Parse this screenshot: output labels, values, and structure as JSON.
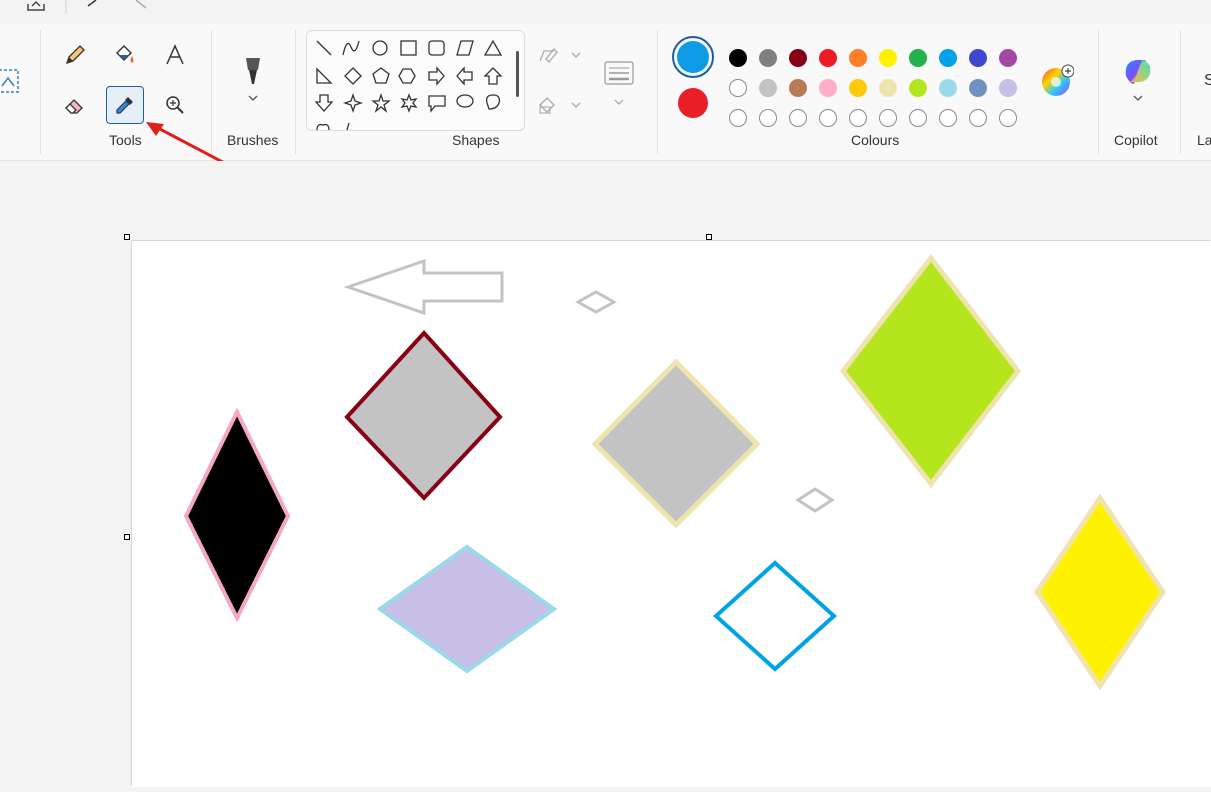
{
  "ribbon": {
    "groups": {
      "tools": "Tools",
      "brushes": "Brushes",
      "shapes": "Shapes",
      "colours": "Colours",
      "copilot": "Copilot",
      "layers_partial": "La"
    },
    "tools": [
      "pencil",
      "fill",
      "text",
      "eraser",
      "color-picker",
      "magnifier"
    ],
    "selected_tool": "color-picker",
    "primary_colour": "#0c9be4",
    "secondary_colour": "#e81f27",
    "palette_row1": [
      "#000000",
      "#7f7f7f",
      "#880015",
      "#ed1c24",
      "#ff7f27",
      "#fff200",
      "#22b14c",
      "#00a2e8",
      "#3f48cc",
      "#a349a4"
    ],
    "palette_row2": [
      "#ffffff",
      "#c3c3c3",
      "#b97a57",
      "#ffaec9",
      "#ffc90e",
      "#efe4b0",
      "#b5e61d",
      "#99d9ea",
      "#7092be",
      "#c8bfe7"
    ],
    "palette_row3_count": 10
  },
  "canvas": {
    "shapes": [
      {
        "name": "black-diamond",
        "fill": "#000000",
        "stroke": "#f4a9c0"
      },
      {
        "name": "gray-diamond-red-outline",
        "fill": "#c3c3c3",
        "stroke": "#880015"
      },
      {
        "name": "purple-diamond",
        "fill": "#c8bfe7",
        "stroke": "#99d9ea"
      },
      {
        "name": "gray-diamond-cream-outline",
        "fill": "#c3c3c3",
        "stroke": "#efe4b0"
      },
      {
        "name": "green-diamond",
        "fill": "#b5e61d",
        "stroke": "#efe4b0"
      },
      {
        "name": "blue-outline-diamond",
        "fill": "none",
        "stroke": "#00a2e8"
      },
      {
        "name": "yellow-diamond",
        "fill": "#fff200",
        "stroke": "#efe4b0"
      }
    ]
  }
}
